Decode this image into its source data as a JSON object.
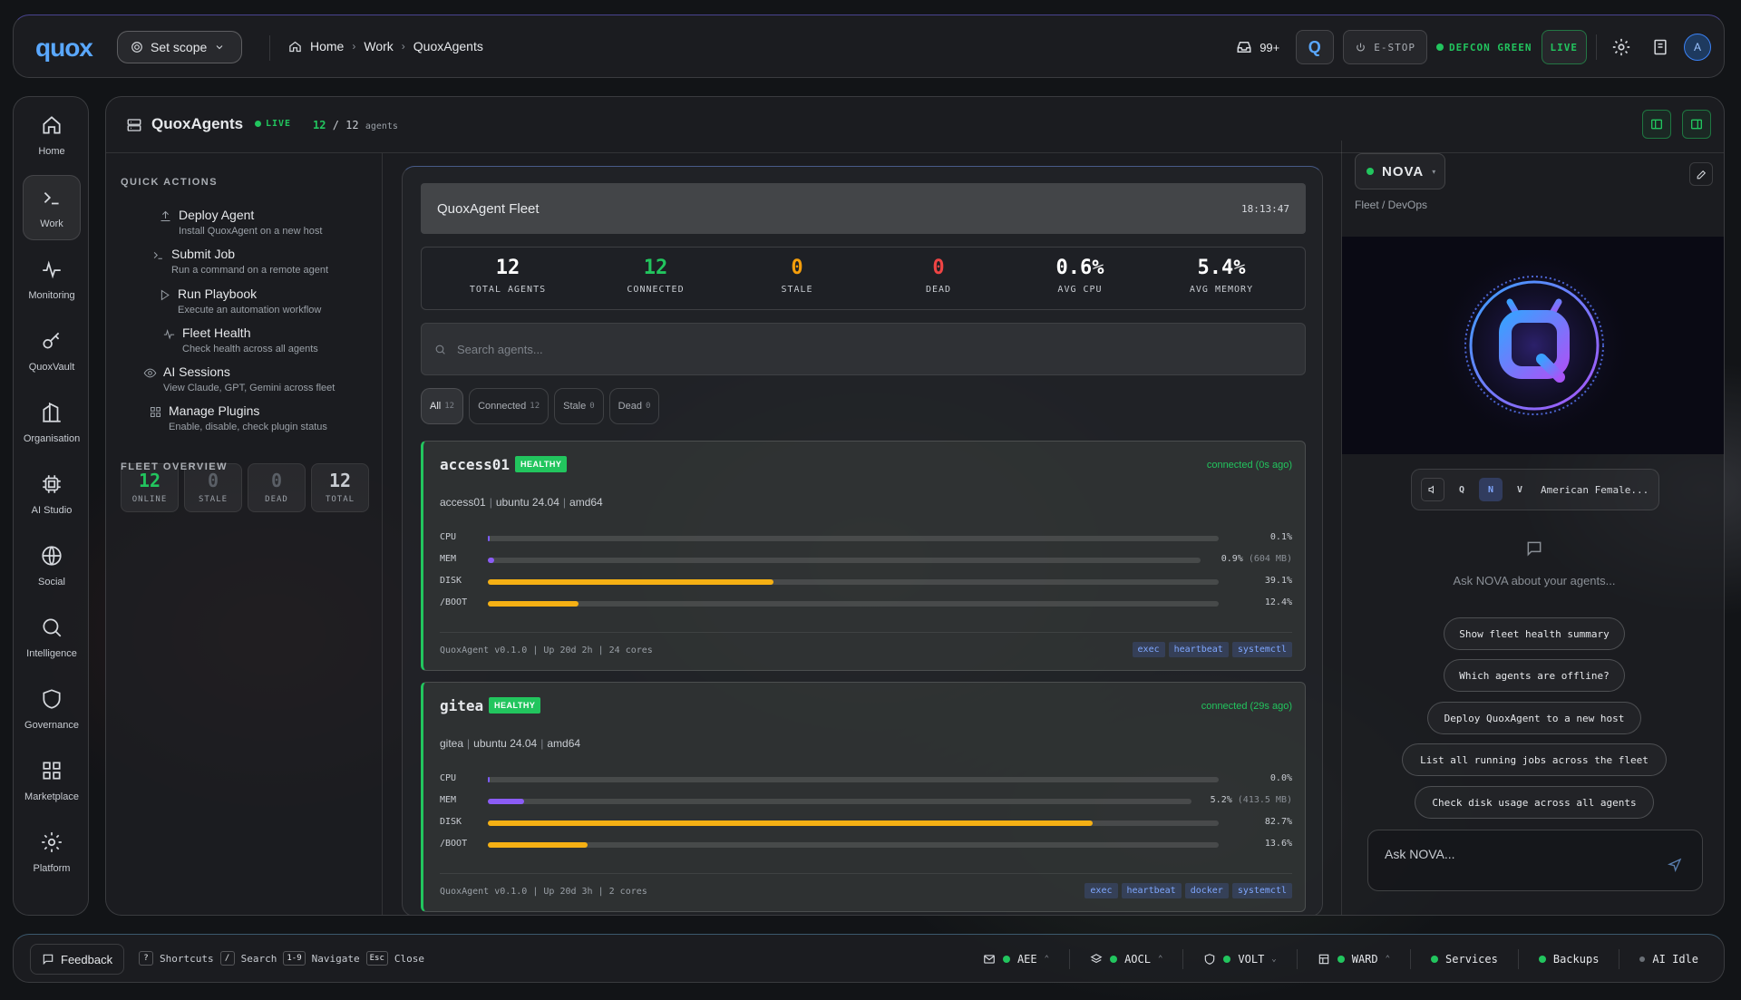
{
  "topbar": {
    "logo": "quox",
    "scope_label": "Set scope",
    "breadcrumbs": [
      "Home",
      "Work",
      "QuoxAgents"
    ],
    "inbox_count": "99+",
    "estop_label": "E-STOP",
    "defcon_label": "DEFCON GREEN",
    "live_label": "LIVE",
    "avatar_initial": "A"
  },
  "sidebar": {
    "items": [
      {
        "label": "Home",
        "icon": "home-icon"
      },
      {
        "label": "Work",
        "icon": "terminal-icon"
      },
      {
        "label": "Monitoring",
        "icon": "activity-icon"
      },
      {
        "label": "QuoxVault",
        "icon": "key-icon"
      },
      {
        "label": "Organisation",
        "icon": "building-icon"
      },
      {
        "label": "AI Studio",
        "icon": "cpu-icon"
      },
      {
        "label": "Social",
        "icon": "globe-icon"
      },
      {
        "label": "Intelligence",
        "icon": "search-icon"
      },
      {
        "label": "Governance",
        "icon": "shield-icon"
      },
      {
        "label": "Marketplace",
        "icon": "grid-icon"
      },
      {
        "label": "Platform",
        "icon": "gear-icon"
      }
    ]
  },
  "header": {
    "title": "QuoxAgents",
    "live_badge": "LIVE",
    "agents_count": "12",
    "agents_total": "/ 12",
    "agents_suffix": "agents"
  },
  "quick_actions": {
    "title": "QUICK ACTIONS",
    "items": [
      {
        "label": "Deploy Agent",
        "desc": "Install QuoxAgent on a new host"
      },
      {
        "label": "Submit Job",
        "desc": "Run a command on a remote agent"
      },
      {
        "label": "Run Playbook",
        "desc": "Execute an automation workflow"
      },
      {
        "label": "Fleet Health",
        "desc": "Check health across all agents"
      },
      {
        "label": "AI Sessions",
        "desc": "View Claude, GPT, Gemini across fleet"
      },
      {
        "label": "Manage Plugins",
        "desc": "Enable, disable, check plugin status"
      }
    ]
  },
  "fleet_overview": {
    "title": "FLEET OVERVIEW",
    "stats": [
      {
        "value": "12",
        "label": "ONLINE",
        "color": "#22c55e"
      },
      {
        "value": "0",
        "label": "STALE",
        "color": "#5a5f66"
      },
      {
        "value": "0",
        "label": "DEAD",
        "color": "#5a5f66"
      },
      {
        "value": "12",
        "label": "TOTAL",
        "color": "#c8ccd2"
      }
    ]
  },
  "fleet": {
    "title": "QuoxAgent Fleet",
    "time": "18:13:47",
    "stats": [
      {
        "value": "12",
        "label": "TOTAL AGENTS",
        "color": "#ffffff"
      },
      {
        "value": "12",
        "label": "CONNECTED",
        "color": "#22c55e"
      },
      {
        "value": "0",
        "label": "STALE",
        "color": "#f59e0b"
      },
      {
        "value": "0",
        "label": "DEAD",
        "color": "#ef4444"
      },
      {
        "value": "0.6%",
        "label": "AVG CPU",
        "color": "#ffffff"
      },
      {
        "value": "5.4%",
        "label": "AVG MEMORY",
        "color": "#ffffff"
      }
    ],
    "search_placeholder": "Search agents...",
    "filters": [
      {
        "label": "All",
        "count": "12"
      },
      {
        "label": "Connected",
        "count": "12"
      },
      {
        "label": "Stale",
        "count": "0"
      },
      {
        "label": "Dead",
        "count": "0"
      }
    ],
    "agents": [
      {
        "name": "access01",
        "status": "HEALTHY",
        "connected": "connected (0s ago)",
        "host": "access01",
        "os": "ubuntu 24.04",
        "arch": "amd64",
        "metrics": [
          {
            "key": "CPU",
            "value": "0.1%",
            "extra": "",
            "percent": 0.1,
            "color": "#7c5cff"
          },
          {
            "key": "MEM",
            "value": "0.9%",
            "extra": "(604 MB)",
            "percent": 0.9,
            "color": "#8b5cf6"
          },
          {
            "key": "DISK",
            "value": "39.1%",
            "extra": "",
            "percent": 39.1,
            "color": "#f5b014"
          },
          {
            "key": "/BOOT",
            "value": "12.4%",
            "extra": "",
            "percent": 12.4,
            "color": "#f5b014"
          }
        ],
        "footer": "QuoxAgent v0.1.0 | Up 20d 2h | 24 cores",
        "tags": [
          "exec",
          "heartbeat",
          "systemctl"
        ]
      },
      {
        "name": "gitea",
        "status": "HEALTHY",
        "connected": "connected (29s ago)",
        "host": "gitea",
        "os": "ubuntu 24.04",
        "arch": "amd64",
        "metrics": [
          {
            "key": "CPU",
            "value": "0.0%",
            "extra": "",
            "percent": 0.0,
            "color": "#7c5cff"
          },
          {
            "key": "MEM",
            "value": "5.2%",
            "extra": "(413.5 MB)",
            "percent": 5.2,
            "color": "#8b5cf6"
          },
          {
            "key": "DISK",
            "value": "82.7%",
            "extra": "",
            "percent": 82.7,
            "color": "#f5b014"
          },
          {
            "key": "/BOOT",
            "value": "13.6%",
            "extra": "",
            "percent": 13.6,
            "color": "#f5b014"
          }
        ],
        "footer": "QuoxAgent v0.1.0 | Up 20d 3h | 2 cores",
        "tags": [
          "exec",
          "heartbeat",
          "docker",
          "systemctl"
        ]
      }
    ]
  },
  "nova": {
    "name": "NOVA",
    "subtitle": "Fleet / DevOps",
    "voice_buttons": [
      "Q",
      "N",
      "V"
    ],
    "voice_name": "American Female...",
    "prompt": "Ask NOVA about your agents...",
    "suggestions": [
      "Show fleet health summary",
      "Which agents are offline?",
      "Deploy QuoxAgent to a new host",
      "List all running jobs across the fleet",
      "Check disk usage across all agents"
    ],
    "input_placeholder": "Ask NOVA..."
  },
  "bottombar": {
    "feedback": "Feedback",
    "shortcuts": [
      {
        "key": "?",
        "label": "Shortcuts"
      },
      {
        "key": "/",
        "label": "Search"
      },
      {
        "key": "1-9",
        "label": "Navigate"
      },
      {
        "key": "Esc",
        "label": "Close"
      }
    ],
    "status": [
      {
        "label": "AEE"
      },
      {
        "label": "AOCL"
      },
      {
        "label": "VOLT"
      },
      {
        "label": "WARD"
      },
      {
        "label": "Services"
      },
      {
        "label": "Backups"
      },
      {
        "label": "AI Idle"
      }
    ]
  }
}
